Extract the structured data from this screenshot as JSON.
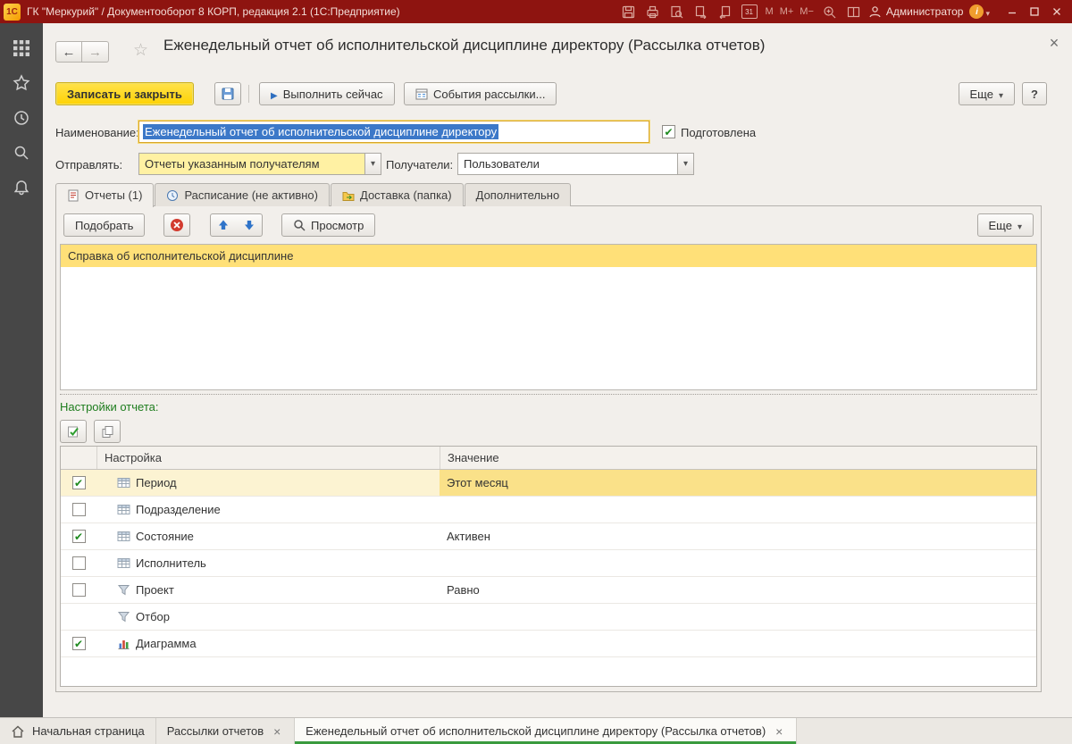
{
  "titlebar": {
    "logo_text": "1С",
    "title": "ГК \"Меркурий\" / Документооборот 8 КОРП, редакция 2.1  (1С:Предприятие)",
    "calendar_day": "31",
    "memory_m": "M",
    "memory_m_plus": "M+",
    "memory_m_minus": "M−",
    "user_name": "Администратор"
  },
  "header": {
    "title": "Еженедельный отчет об исполнительской дисциплине директору (Рассылка отчетов)"
  },
  "toolbar": {
    "save_close_label": "Записать и закрыть",
    "run_now_label": "Выполнить сейчас",
    "events_label": "События рассылки...",
    "more_label": "Еще",
    "help_label": "?"
  },
  "form": {
    "name_label": "Наименование:",
    "name_value": "Еженедельный отчет об исполнительской дисциплине директору",
    "prepared_label": "Подготовлена",
    "send_label": "Отправлять:",
    "send_value": "Отчеты указанным получателям",
    "recipients_label": "Получатели:",
    "recipients_value": "Пользователи"
  },
  "tabs": [
    {
      "label": "Отчеты (1)",
      "icon": "reports",
      "active": true
    },
    {
      "label": "Расписание (не активно)",
      "icon": "clock",
      "active": false
    },
    {
      "label": "Доставка (папка)",
      "icon": "folder",
      "active": false
    },
    {
      "label": "Дополнительно",
      "icon": "none",
      "active": false
    }
  ],
  "reports": {
    "pick_label": "Подобрать",
    "preview_label": "Просмотр",
    "more_label": "Еще",
    "items": [
      {
        "name": "Справка об исполнительской дисциплине",
        "selected": true
      }
    ]
  },
  "settings": {
    "section_label": "Настройки отчета:",
    "col_setting": "Настройка",
    "col_value": "Значение",
    "rows": [
      {
        "name": "Период",
        "value": "Этот месяц",
        "icon": "table",
        "has_checkbox": true,
        "checked": true,
        "highlighted": true
      },
      {
        "name": "Подразделение",
        "value": "",
        "icon": "table",
        "has_checkbox": true,
        "checked": false,
        "highlighted": false
      },
      {
        "name": "Состояние",
        "value": "Активен",
        "icon": "table",
        "has_checkbox": true,
        "checked": true,
        "highlighted": false
      },
      {
        "name": "Исполнитель",
        "value": "",
        "icon": "table",
        "has_checkbox": true,
        "checked": false,
        "highlighted": false
      },
      {
        "name": "Проект",
        "value": "Равно",
        "icon": "filter",
        "has_checkbox": true,
        "checked": false,
        "highlighted": false
      },
      {
        "name": "Отбор",
        "value": "",
        "icon": "filter",
        "has_checkbox": false,
        "checked": false,
        "highlighted": false
      },
      {
        "name": "Диаграмма",
        "value": "",
        "icon": "chart",
        "has_checkbox": true,
        "checked": true,
        "highlighted": false
      }
    ]
  },
  "bottom_tabs": [
    {
      "label": "Начальная страница",
      "icon": "home",
      "closable": false,
      "active": false
    },
    {
      "label": "Рассылки отчетов",
      "icon": "none",
      "closable": true,
      "active": false
    },
    {
      "label": "Еженедельный отчет об исполнительской дисциплине директору (Рассылка отчетов)",
      "icon": "none",
      "closable": true,
      "active": true
    }
  ]
}
